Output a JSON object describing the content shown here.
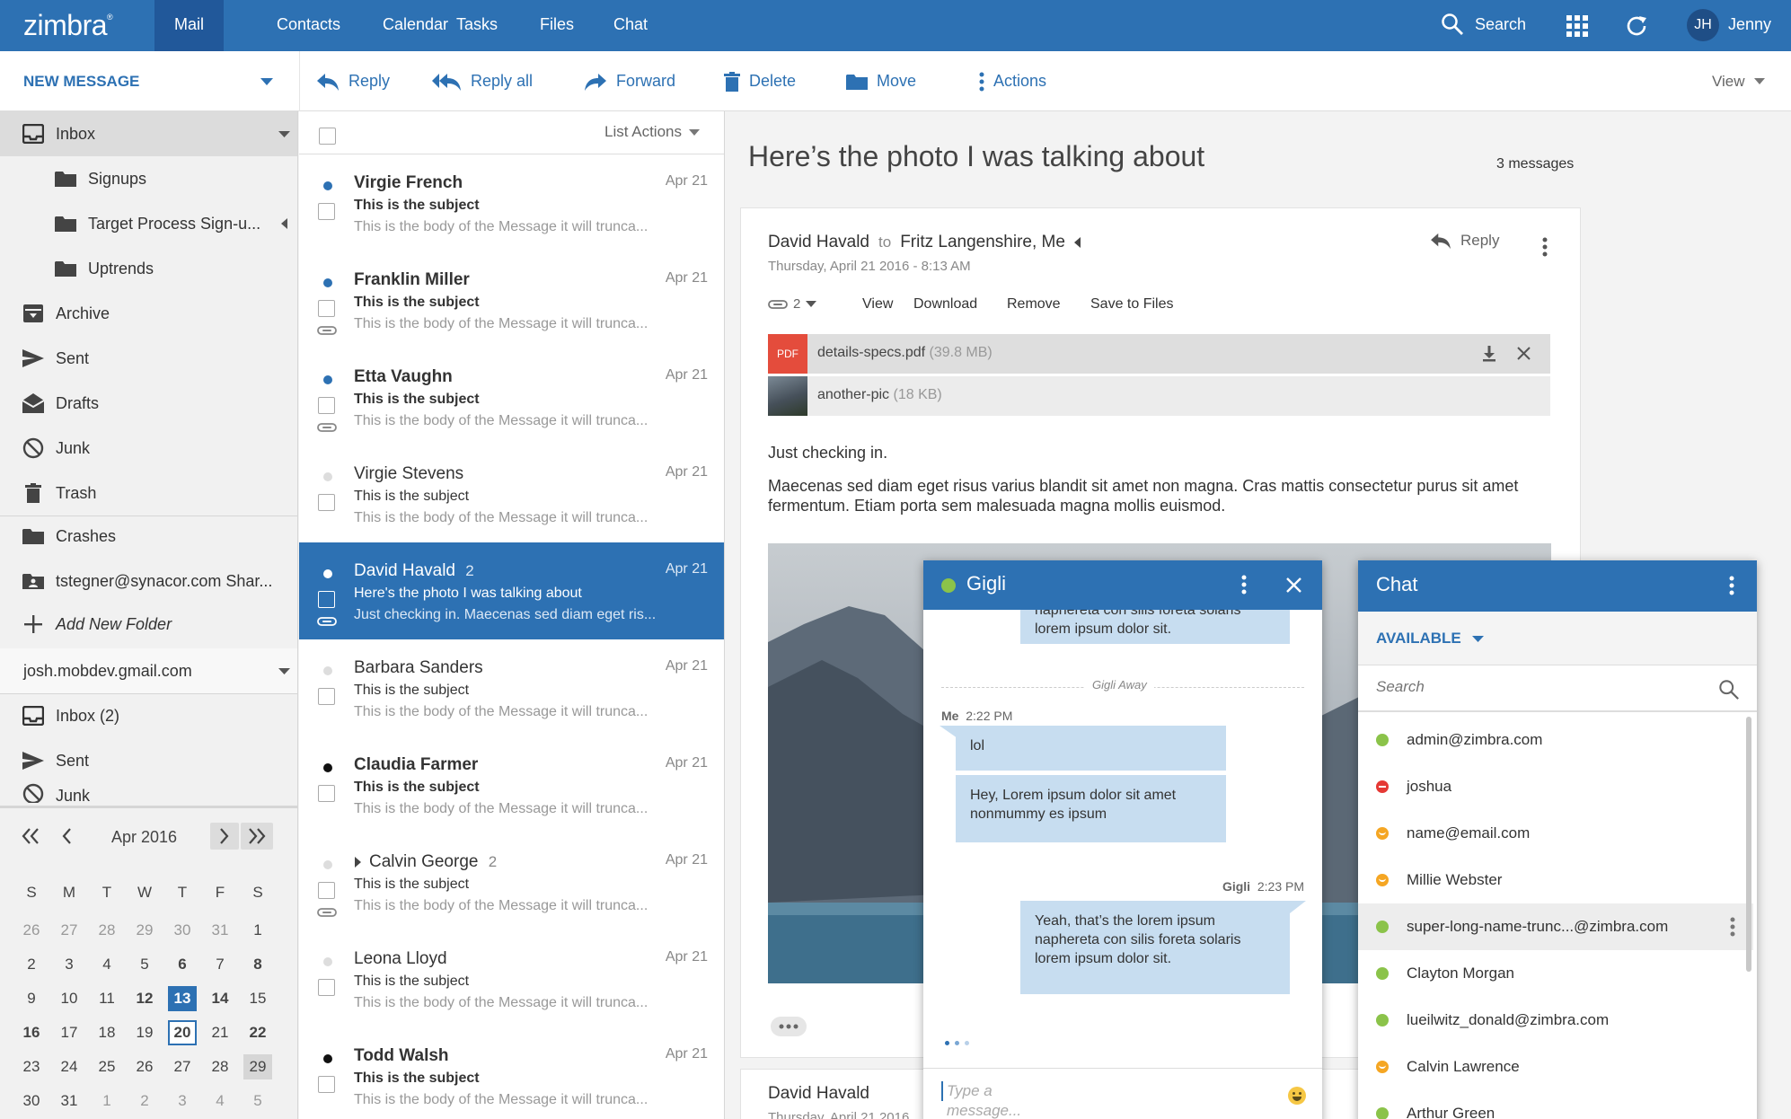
{
  "topbar": {
    "logo": "zimbra",
    "tabs": [
      {
        "label": "Mail"
      },
      {
        "label": "Contacts"
      },
      {
        "label": "Calendar"
      },
      {
        "label": "Tasks"
      },
      {
        "label": "Files"
      },
      {
        "label": "Chat"
      }
    ],
    "search_label": "Search",
    "user_initials": "JH",
    "user_name": "Jenny"
  },
  "toolbar": {
    "new_message": "NEW MESSAGE",
    "reply": "Reply",
    "reply_all": "Reply all",
    "forward": "Forward",
    "delete": "Delete",
    "move": "Move",
    "actions": "Actions",
    "view": "View"
  },
  "folders": {
    "items": [
      {
        "label": "Inbox"
      },
      {
        "label": "Signups"
      },
      {
        "label": "Target Process Sign-u..."
      },
      {
        "label": "Uptrends"
      },
      {
        "label": "Archive"
      },
      {
        "label": "Sent"
      },
      {
        "label": "Drafts"
      },
      {
        "label": "Junk"
      },
      {
        "label": "Trash"
      },
      {
        "label": "Crashes"
      },
      {
        "label": "tstegner@synacor.com Shar..."
      },
      {
        "label": "Add New Folder"
      }
    ],
    "account": "josh.mobdev.gmail.com",
    "account_items": [
      {
        "label": "Inbox (2)"
      },
      {
        "label": "Sent"
      },
      {
        "label": "Junk"
      }
    ]
  },
  "calendar": {
    "month": "Apr 2016",
    "weekdays": [
      "S",
      "M",
      "T",
      "W",
      "T",
      "F",
      "S"
    ],
    "days": [
      "26",
      "27",
      "28",
      "29",
      "30",
      "31",
      "1",
      "2",
      "3",
      "4",
      "5",
      "6",
      "7",
      "8",
      "9",
      "10",
      "11",
      "12",
      "13",
      "14",
      "15",
      "16",
      "17",
      "18",
      "19",
      "20",
      "21",
      "22",
      "23",
      "24",
      "25",
      "26",
      "27",
      "28",
      "29",
      "30",
      "31",
      "1",
      "2",
      "3",
      "4",
      "5"
    ]
  },
  "message_list": {
    "list_actions": "List Actions",
    "messages": [
      {
        "from": "Virgie French",
        "count": "",
        "date": "Apr 21",
        "subject": "This is the subject",
        "body": "This is the body of the Message it will trunca..."
      },
      {
        "from": "Franklin Miller",
        "count": "",
        "date": "Apr 21",
        "subject": "This is the subject",
        "body": "This is the body of the Message it will trunca..."
      },
      {
        "from": "Etta Vaughn",
        "count": "",
        "date": "Apr 21",
        "subject": "This is the subject",
        "body": "This is the body of the Message it will trunca..."
      },
      {
        "from": "Virgie Stevens",
        "count": "",
        "date": "Apr 21",
        "subject": "This is the subject",
        "body": "This is the body of the Message it will trunca..."
      },
      {
        "from": "David Havald",
        "count": "2",
        "date": "Apr 21",
        "subject": "Here's the photo I was talking about",
        "body": "Just checking in. Maecenas sed diam eget ris..."
      },
      {
        "from": "Barbara Sanders",
        "count": "",
        "date": "Apr 21",
        "subject": "This is the subject",
        "body": "This is the body of the Message it will trunca..."
      },
      {
        "from": "Claudia Farmer",
        "count": "",
        "date": "Apr 21",
        "subject": "This is the subject",
        "body": "This is the body of the Message it will trunca..."
      },
      {
        "from": "Calvin George",
        "count": "2",
        "date": "Apr 21",
        "subject": "This is the subject",
        "body": "This is the body of the Message it will trunca..."
      },
      {
        "from": "Leona Lloyd",
        "count": "",
        "date": "Apr 21",
        "subject": "This is the subject",
        "body": "This is the body of the Message it will trunca..."
      },
      {
        "from": "Todd Walsh",
        "count": "",
        "date": "Apr 21",
        "subject": "This is the subject",
        "body": "This is the body of the Message it will trunca..."
      }
    ]
  },
  "reading": {
    "subject": "Here’s the photo I was talking about",
    "message_count": "3 messages",
    "sender": "David Havald",
    "to_label": "to",
    "recipients": "Fritz Langenshire, Me",
    "date": "Thursday, April 21 2016 - 8:13 AM",
    "reply": "Reply",
    "attach_count": "2",
    "attach_actions": [
      "View",
      "Download",
      "Remove",
      "Save to Files"
    ],
    "attachments": [
      {
        "badge": "PDF",
        "name": "details-specs.pdf",
        "size": "(39.8 MB)"
      },
      {
        "badge": "",
        "name": "another-pic",
        "size": "(18 KB)"
      }
    ],
    "body_intro": "Just checking in.",
    "body_text": "Maecenas sed diam eget risus varius blandit sit amet non magna. Cras mattis consectetur purus sit amet fermentum. Etiam porta sem malesuada magna mollis euismod.",
    "second_sender": "David Havald",
    "second_date": "Thursday, April 21 2016"
  },
  "gigli_chat": {
    "title": "Gigli",
    "partial_bubble": "naphereta con silis foreta solaris lorem ipsum dolor sit.",
    "status_divider": "Gigli Away",
    "me_label": "Me",
    "me_time": "2:22 PM",
    "me_msgs": [
      "lol",
      "Hey, Lorem ipsum dolor sit amet nonmummy es ipsum"
    ],
    "them_label": "Gigli",
    "them_time": "2:23 PM",
    "them_msg": "Yeah, that’s the lorem ipsum naphereta con silis foreta solaris lorem ipsum dolor sit.",
    "input_placeholder": "Type a message..."
  },
  "chat_panel": {
    "title": "Chat",
    "status": "AVAILABLE",
    "search_placeholder": "Search",
    "contacts": [
      {
        "name": "admin@zimbra.com",
        "status": "available"
      },
      {
        "name": "joshua",
        "status": "busy"
      },
      {
        "name": "name@email.com",
        "status": "away"
      },
      {
        "name": "Millie Webster",
        "status": "away"
      },
      {
        "name": "super-long-name-trunc...@zimbra.com",
        "status": "available"
      },
      {
        "name": "Clayton Morgan",
        "status": "available"
      },
      {
        "name": "lueilwitz_donald@zimbra.com",
        "status": "available"
      },
      {
        "name": "Calvin Lawrence",
        "status": "away"
      },
      {
        "name": "Arthur Green",
        "status": "available"
      }
    ]
  },
  "colors": {
    "brand": "#2d71b3",
    "nav_active": "#21589a",
    "available": "#8bc34a",
    "busy": "#e53935",
    "away": "#f5a623",
    "bubble": "#c7ddf0"
  }
}
